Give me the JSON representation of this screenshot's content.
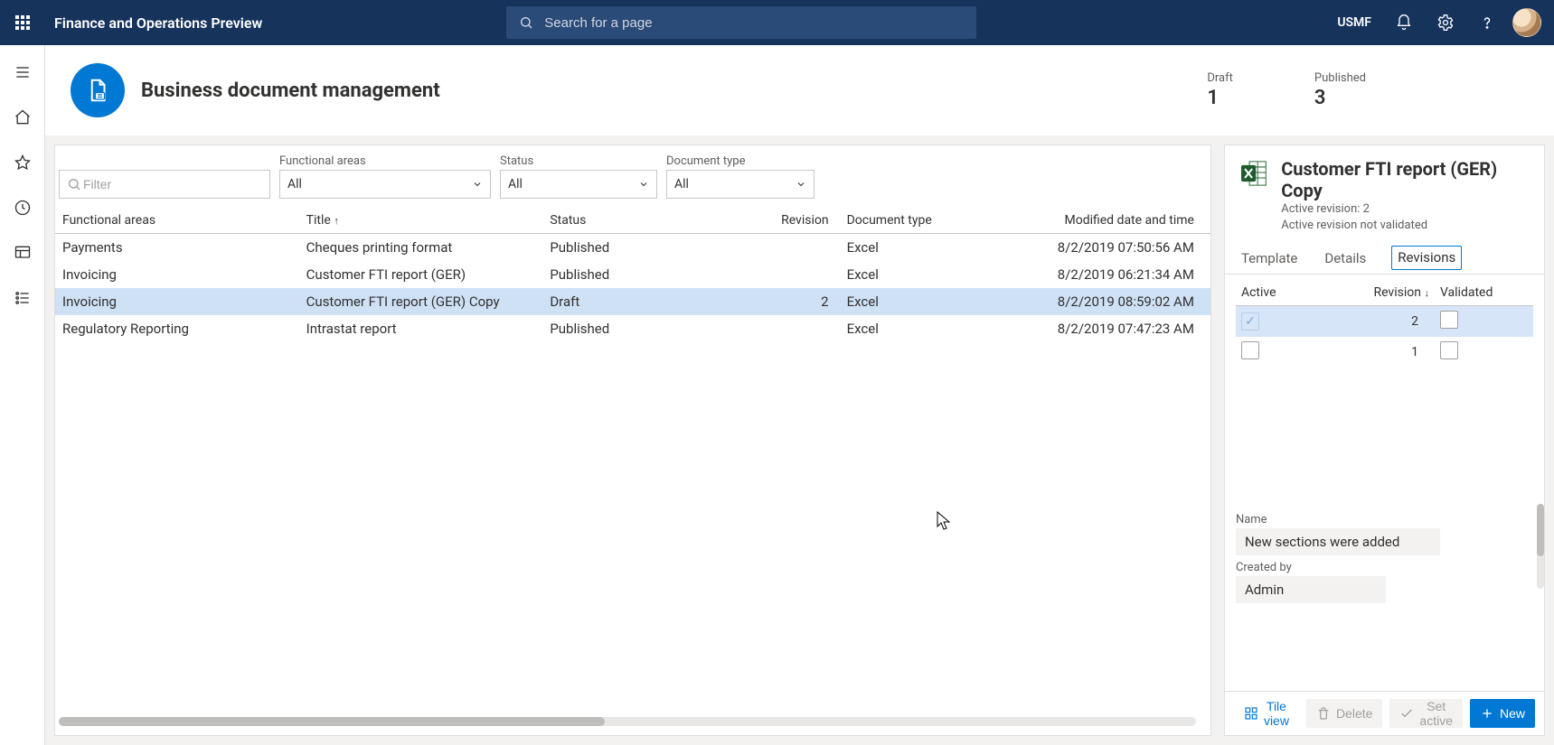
{
  "topbar": {
    "app_title": "Finance and Operations Preview",
    "search_placeholder": "Search for a page",
    "company": "USMF"
  },
  "page": {
    "title": "Business document management",
    "stats": {
      "draft_label": "Draft",
      "draft_value": "1",
      "published_label": "Published",
      "published_value": "3"
    }
  },
  "filters": {
    "filter_placeholder": "Filter",
    "functional_areas_label": "Functional areas",
    "functional_areas_value": "All",
    "status_label": "Status",
    "status_value": "All",
    "doctype_label": "Document type",
    "doctype_value": "All"
  },
  "grid": {
    "columns": {
      "functional_areas": "Functional areas",
      "title": "Title",
      "status": "Status",
      "revision": "Revision",
      "document_type": "Document type",
      "modified": "Modified date and time"
    },
    "rows": [
      {
        "fa": "Payments",
        "title": "Cheques printing format",
        "status": "Published",
        "revision": "",
        "doctype": "Excel",
        "modified": "8/2/2019 07:50:56 AM",
        "selected": false
      },
      {
        "fa": "Invoicing",
        "title": "Customer FTI report (GER)",
        "status": "Published",
        "revision": "",
        "doctype": "Excel",
        "modified": "8/2/2019 06:21:34 AM",
        "selected": false
      },
      {
        "fa": "Invoicing",
        "title": "Customer FTI report (GER) Copy",
        "status": "Draft",
        "revision": "2",
        "doctype": "Excel",
        "modified": "8/2/2019 08:59:02 AM",
        "selected": true
      },
      {
        "fa": "Regulatory Reporting",
        "title": "Intrastat report",
        "status": "Published",
        "revision": "",
        "doctype": "Excel",
        "modified": "8/2/2019 07:47:23 AM",
        "selected": false
      }
    ]
  },
  "detail": {
    "title": "Customer FTI report (GER) Copy",
    "sub1": "Active revision: 2",
    "sub2": "Active revision not validated",
    "tabs": {
      "template": "Template",
      "details": "Details",
      "revisions": "Revisions"
    },
    "rev_columns": {
      "active": "Active",
      "revision": "Revision",
      "validated": "Validated"
    },
    "rev_rows": [
      {
        "active": true,
        "revision": "2",
        "validated": false,
        "selected": true
      },
      {
        "active": false,
        "revision": "1",
        "validated": false,
        "selected": false
      }
    ],
    "name_label": "Name",
    "name_value": "New sections were added",
    "createdby_label": "Created by",
    "createdby_value": "Admin",
    "actions": {
      "tile_view": "Tile view",
      "delete": "Delete",
      "set_active": "Set active",
      "new": "New"
    }
  }
}
